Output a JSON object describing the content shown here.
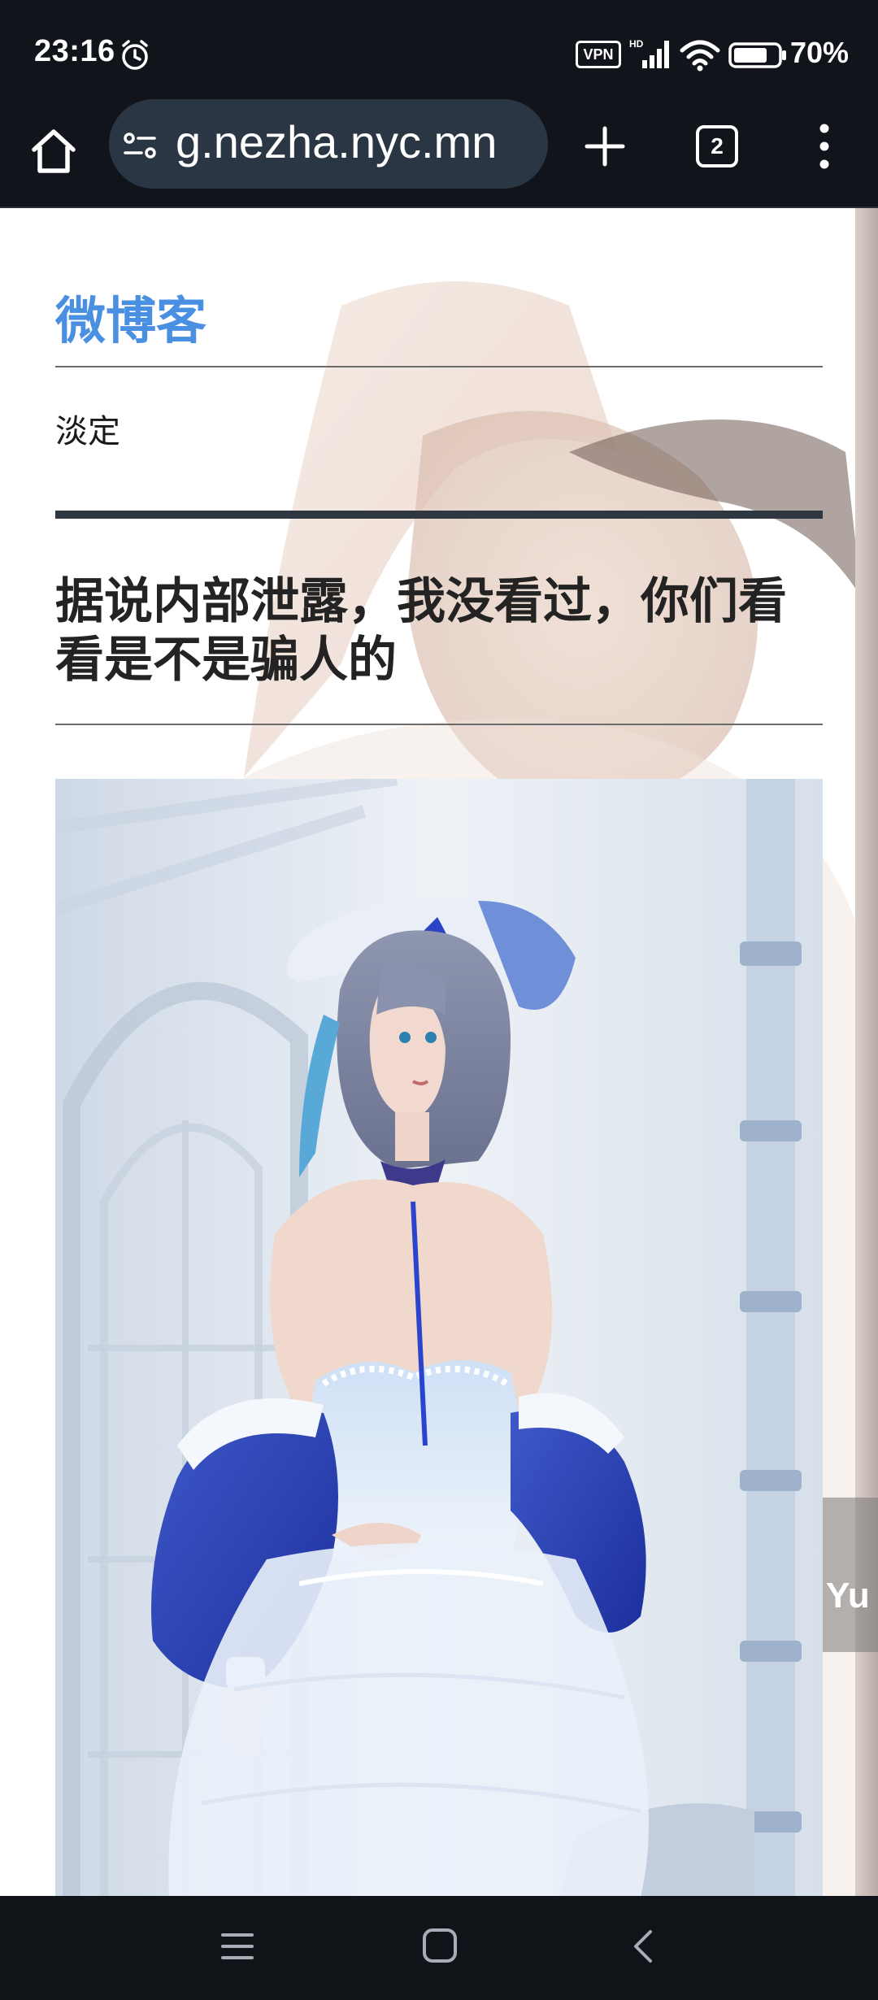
{
  "status_bar": {
    "time": "23:16",
    "vpn": "VPN",
    "network": "HD",
    "battery": "70%",
    "icons": [
      "alarm-icon",
      "signal-icon",
      "wifi-icon",
      "battery-icon"
    ]
  },
  "browser": {
    "url": "g.nezha.nyc.mn",
    "tab_count": "2",
    "icons": [
      "home-icon",
      "site-info-icon",
      "plus-icon",
      "tab-switcher-icon",
      "more-vert-icon"
    ]
  },
  "page": {
    "blog_title": "微博客",
    "subtitle": "淡定",
    "post_title": "据说内部泄露，我没看过，你们看看是不是骗人的",
    "floating_label": "Yu",
    "colors": {
      "accent": "#4a90e2",
      "divider": "#2f3740",
      "toolbar": "#11141a",
      "url_pill": "#2b3644"
    }
  },
  "nav": {
    "icons": [
      "menu-icon",
      "home-square-icon",
      "back-chevron-icon"
    ]
  }
}
